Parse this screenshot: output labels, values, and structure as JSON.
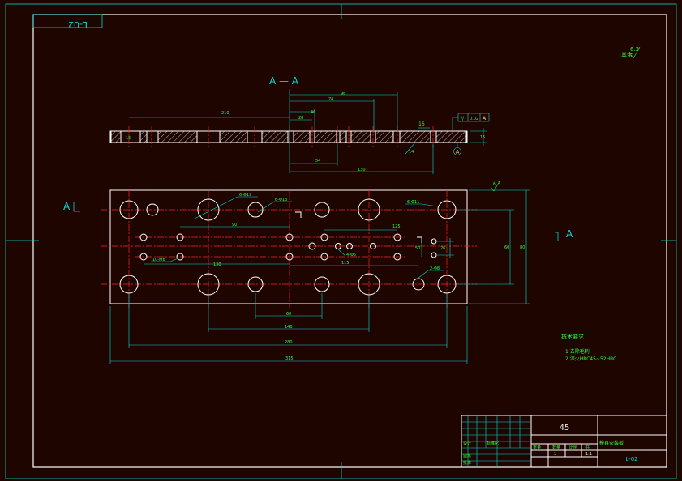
{
  "drawing": {
    "code_top_rotated": "L-02",
    "section_label": "A — A",
    "view_arrow_left": "A",
    "view_arrow_right": "A",
    "roughness_corner": "6.3",
    "roughness_corner_prefix": "其余",
    "roughness_plan": "6.3",
    "section_dims": {
      "d210": "210",
      "d96": "96",
      "d74": "74",
      "d46": "46",
      "d28": "28",
      "d54": "54",
      "d130": "130",
      "d16": "16",
      "d14": "14",
      "thickness": "15"
    },
    "tolerance_frame": {
      "symbol": "//",
      "value": "0.02",
      "datum": "A"
    },
    "datum_circle": "A",
    "plan_dims": {
      "hole_6_phi19": "6-Φ19",
      "hole_6_phi13": "6-Φ13",
      "hole_6_phi11": "6-Φ11",
      "hole_10_m6": "10-M6",
      "hole_4_phi5": "4-Φ5",
      "hole_2_phi8": "2-Φ8",
      "d90": "90",
      "d130": "130",
      "d125": "125",
      "d115": "115",
      "d60": "60",
      "d140": "140",
      "d280": "280",
      "d315": "315",
      "d60_right": "60",
      "d26": "26",
      "d50": "50",
      "d80": "80"
    },
    "tech_requirements": {
      "title": "技术要求",
      "item1": "1 去除毛刺",
      "item2": "2 淬火HRC45~52HRC"
    },
    "title_block": {
      "material": "45",
      "part_name": "模具安装板",
      "drawing_code": "L-02",
      "scale": "1:1",
      "sheet": "1",
      "sheets": "1",
      "label_weight": "重量",
      "label_scale": "比例",
      "label_qty": "数量",
      "label_sheet": "共",
      "label_design": "设计",
      "label_check": "审核",
      "label_approve": "批准",
      "label_std": "标准化"
    }
  }
}
